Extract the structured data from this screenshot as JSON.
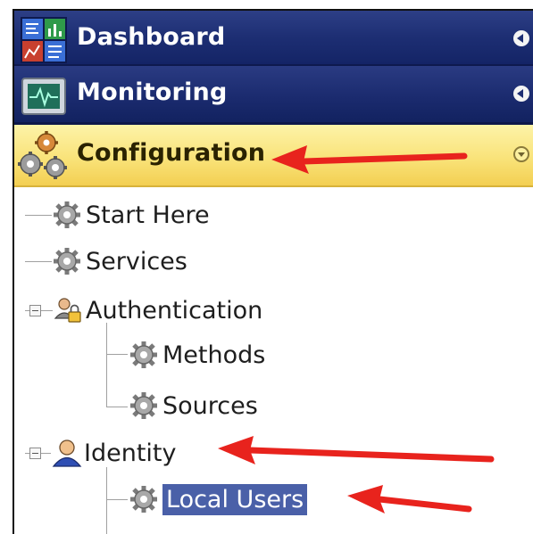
{
  "nav": {
    "dashboard_label": "Dashboard",
    "monitoring_label": "Monitoring",
    "configuration_label": "Configuration"
  },
  "tree": {
    "start_here": "Start Here",
    "services": "Services",
    "authentication": "Authentication",
    "methods": "Methods",
    "sources": "Sources",
    "identity": "Identity",
    "local_users": "Local Users"
  },
  "colors": {
    "nav_band": "#1d2e73",
    "config_band": "#f9e37a",
    "selected": "#4a60a8",
    "annotation_arrow": "#e8231d"
  }
}
